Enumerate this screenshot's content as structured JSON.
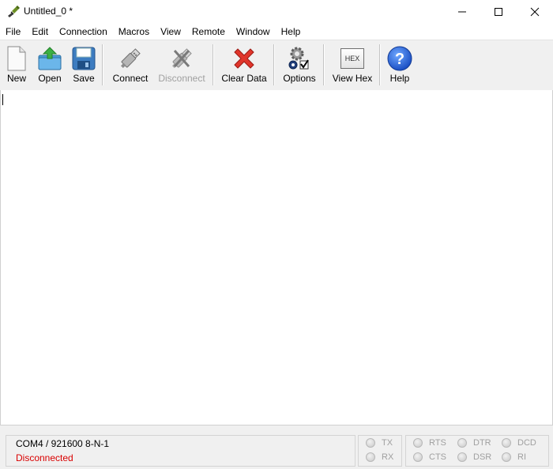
{
  "window": {
    "title": "Untitled_0 *"
  },
  "menu": [
    "File",
    "Edit",
    "Connection",
    "Macros",
    "View",
    "Remote",
    "Window",
    "Help"
  ],
  "toolbar": {
    "new": "New",
    "open": "Open",
    "save": "Save",
    "connect": "Connect",
    "disconnect": "Disconnect",
    "clear": "Clear Data",
    "options": "Options",
    "viewhex": "View Hex",
    "hex_icon_text": "HEX",
    "help": "Help"
  },
  "status": {
    "port": "COM4 / 921600 8-N-1",
    "connection": "Disconnected",
    "connection_color": "#d90000"
  },
  "signals": {
    "tx": "TX",
    "rx": "RX",
    "rts": "RTS",
    "cts": "CTS",
    "dtr": "DTR",
    "dsr": "DSR",
    "dcd": "DCD",
    "ri": "RI"
  }
}
